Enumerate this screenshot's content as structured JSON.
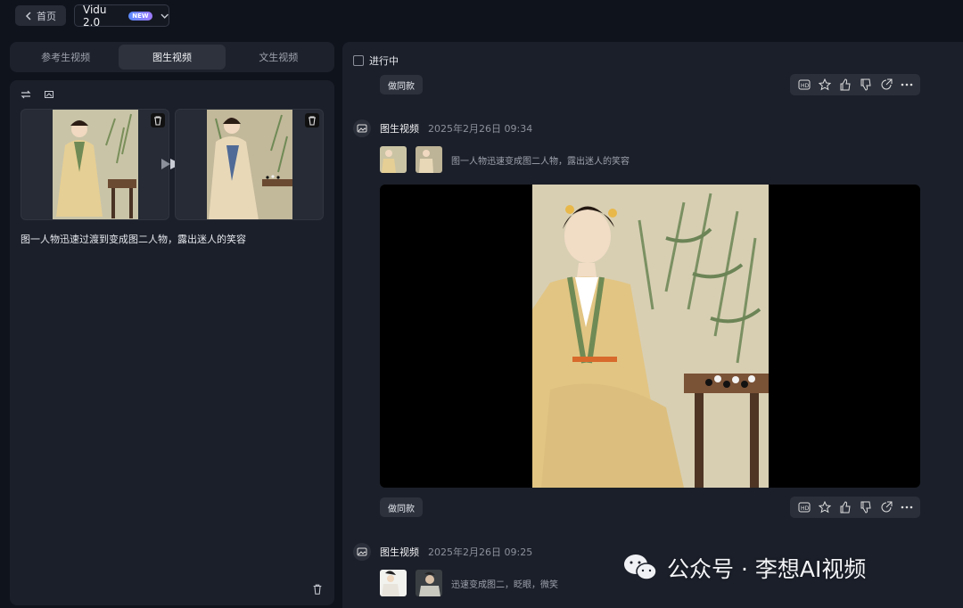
{
  "topbar": {
    "back_label": "首页",
    "model_name": "Vidu 2.0",
    "model_badge": "NEW"
  },
  "left": {
    "tabs": [
      {
        "label": "参考生视频",
        "active": false
      },
      {
        "label": "图生视频",
        "active": true
      },
      {
        "label": "文生视频",
        "active": false
      }
    ],
    "prompt": "图一人物迅速过渡到变成图二人物，露出迷人的笑容"
  },
  "right": {
    "in_progress_label": "进行中",
    "remix_label": "做同款",
    "tasks": [
      {
        "type": "图生视频",
        "time": "2025年2月26日 09:34",
        "prompt": "图一人物迅速变成图二人物，露出迷人的笑容"
      },
      {
        "type": "图生视频",
        "time": "2025年2月26日 09:25",
        "prompt": "迅速变成图二，眨眼，微笑"
      }
    ]
  },
  "watermark": {
    "text": "公众号 · 李想AI视频"
  },
  "colors": {
    "bg": "#0f131c",
    "panel": "#1b1f29",
    "accent": "#5b8cff"
  },
  "icons": [
    "chevron-left-icon",
    "chevron-down-icon",
    "swap-icon",
    "crop-icon",
    "trash-icon",
    "play-forward-icon",
    "hd-icon",
    "star-icon",
    "thumbs-up-icon",
    "thumbs-down-icon",
    "share-icon",
    "more-icon",
    "image-video-icon",
    "wechat-icon"
  ]
}
